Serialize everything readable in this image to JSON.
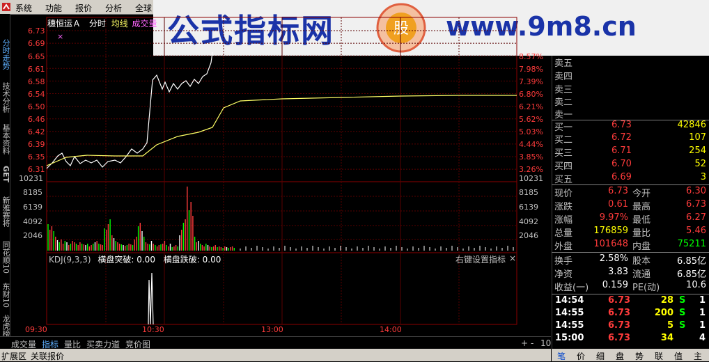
{
  "menu": [
    "系统",
    "功能",
    "报价",
    "分析",
    "全球"
  ],
  "watermark": {
    "text": "公式指标网",
    "url": "www.9m8.cn",
    "seal_char": "股"
  },
  "sidebar": [
    "分时走势",
    "技术分析",
    "基本资料",
    "GET",
    "新雅赛将",
    "同花顺10",
    "东财10",
    "龙虎榜单"
  ],
  "stock": {
    "name": "穗恒运Ａ",
    "mode": "分时",
    "avg_label": "均线",
    "vol_label": "成交量",
    "marker": "×"
  },
  "price_axis_left": [
    "6.73",
    "6.69",
    "6.65",
    "6.61",
    "6.58",
    "6.54",
    "6.50",
    "6.46",
    "6.42",
    "6.39",
    "6.35",
    "6.31"
  ],
  "price_axis_right": [
    "8.57%",
    "7.98%",
    "7.39%",
    "6.80%",
    "6.21%",
    "5.62%",
    "5.03%",
    "4.44%",
    "3.85%",
    "3.26%"
  ],
  "volume_axis": [
    "10231",
    "8185",
    "6139",
    "4092",
    "2046"
  ],
  "kdj": {
    "title": "KDJ(9,3,3)",
    "breakout": "横盘突破: 0.00",
    "breakdown": "横盘跌破: 0.00",
    "settings": "右键设置指标",
    "close": "×"
  },
  "time_axis": [
    "09:30",
    "10:30",
    "13:00",
    "14:00"
  ],
  "bottom_tabs": [
    "成交量",
    "指标",
    "量比",
    "买卖力道",
    "竞价图"
  ],
  "bottom_nav": [
    "+",
    "-",
    "10"
  ],
  "statusbar": [
    "扩展区",
    "关联报价"
  ],
  "asks": [
    {
      "label": "卖五"
    },
    {
      "label": "卖四"
    },
    {
      "label": "卖三"
    },
    {
      "label": "卖二"
    },
    {
      "label": "卖一"
    }
  ],
  "bids": [
    {
      "label": "买一",
      "price": "6.73",
      "vol": "42846"
    },
    {
      "label": "买二",
      "price": "6.72",
      "vol": "107"
    },
    {
      "label": "买三",
      "price": "6.71",
      "vol": "254"
    },
    {
      "label": "买四",
      "price": "6.70",
      "vol": "52"
    },
    {
      "label": "买五",
      "price": "6.69",
      "vol": "3"
    }
  ],
  "fields_left": [
    {
      "label": "现价",
      "value": "6.73",
      "color": "#ff3b3b"
    },
    {
      "label": "涨跌",
      "value": "0.61",
      "color": "#ff3b3b"
    },
    {
      "label": "涨幅",
      "value": "9.97%",
      "color": "#ff3b3b"
    },
    {
      "label": "总量",
      "value": "176859",
      "color": "#ffff00"
    },
    {
      "label": "外盘",
      "value": "101648",
      "color": "#ff3b3b"
    }
  ],
  "fields_right": [
    {
      "label": "今开",
      "value": "6.30",
      "color": "#ff3b3b"
    },
    {
      "label": "最高",
      "value": "6.73",
      "color": "#ff3b3b"
    },
    {
      "label": "最低",
      "value": "6.27",
      "color": "#ff3b3b"
    },
    {
      "label": "量比",
      "value": "5.46",
      "color": "#ff3b3b"
    },
    {
      "label": "内盘",
      "value": "75211",
      "color": "#00ff00"
    }
  ],
  "fields2_left": [
    {
      "label": "换手",
      "value": "2.58%"
    },
    {
      "label": "净资",
      "value": "3.83"
    },
    {
      "label": "收益(一)",
      "value": "0.159"
    }
  ],
  "fields2_right": [
    {
      "label": "股本",
      "value": "6.85亿"
    },
    {
      "label": "流通",
      "value": "6.85亿"
    },
    {
      "label": "PE(动)",
      "value": "10.6"
    }
  ],
  "ticks": [
    {
      "time": "14:54",
      "price": "6.73",
      "vol": "28",
      "bs": "S",
      "n": "1"
    },
    {
      "time": "14:55",
      "price": "6.73",
      "vol": "200",
      "bs": "S",
      "n": "1"
    },
    {
      "time": "14:55",
      "price": "6.73",
      "vol": "5",
      "bs": "S",
      "n": "1"
    },
    {
      "time": "15:00",
      "price": "6.73",
      "vol": "34",
      "bs": "",
      "n": "4"
    }
  ],
  "right_tabs": [
    "笔",
    "价",
    "细",
    "盘",
    "势",
    "联",
    "值",
    "主"
  ]
}
